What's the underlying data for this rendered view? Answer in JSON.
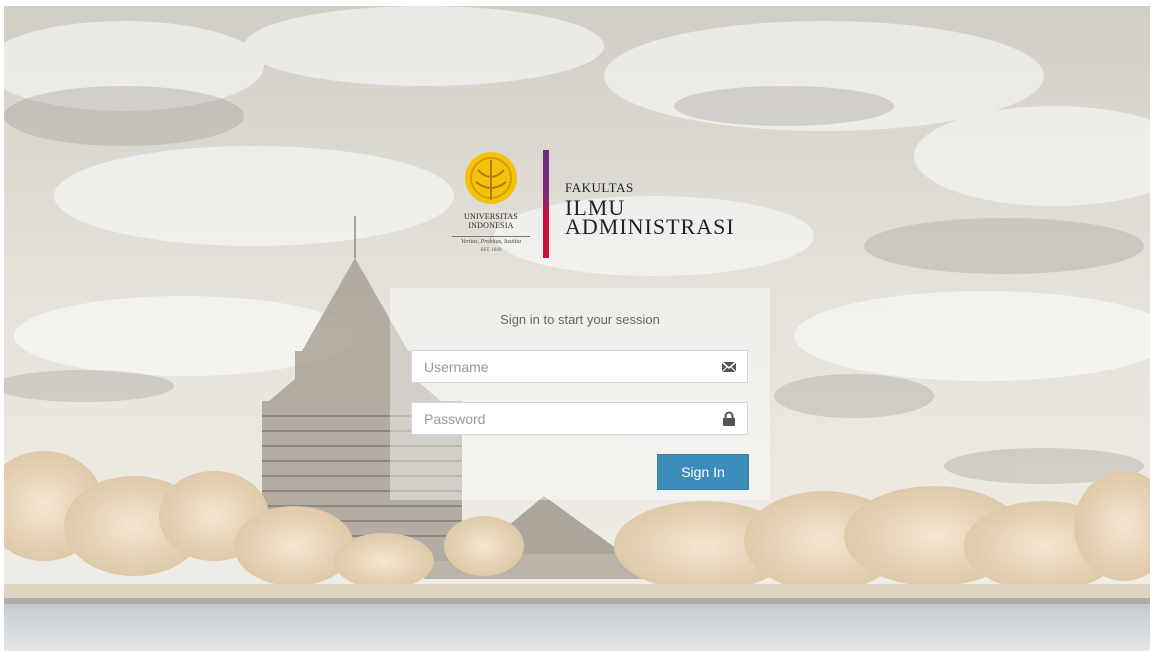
{
  "logo": {
    "university_line1": "UNIVERSITAS",
    "university_line2": "INDONESIA",
    "motto": "Veritas, Probitas, Iustitia",
    "established": "EST. 1849",
    "faculty_line1": "FAKULTAS",
    "faculty_line2": "ILMU",
    "faculty_line3": "ADMINISTRASI",
    "emblem_color": "#f4c20d",
    "bar_colors": [
      "#6a2c83",
      "#c8103e"
    ]
  },
  "login": {
    "message": "Sign in to start your session",
    "username_placeholder": "Username",
    "username_value": "",
    "password_placeholder": "Password",
    "password_value": "",
    "signin_label": "Sign In",
    "username_icon": "envelope-icon",
    "password_icon": "lock-icon",
    "accent_color": "#3c8dbc"
  }
}
